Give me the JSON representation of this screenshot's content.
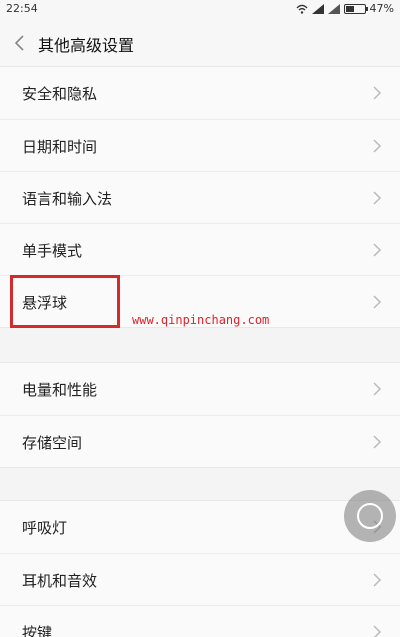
{
  "status_bar": {
    "time": "22:54",
    "battery_percent": "47%",
    "battery_level": 0.47,
    "icons": [
      "wifi-icon",
      "signal-icon",
      "signal-icon",
      "battery-icon"
    ]
  },
  "header": {
    "title": "其他高级设置",
    "back_icon": "chevron-left-icon"
  },
  "groups": [
    {
      "items": [
        {
          "label": "安全和隐私"
        },
        {
          "label": "日期和时间"
        },
        {
          "label": "语言和输入法"
        },
        {
          "label": "单手模式"
        },
        {
          "label": "悬浮球"
        }
      ]
    },
    {
      "items": [
        {
          "label": "电量和性能"
        },
        {
          "label": "存储空间"
        }
      ]
    },
    {
      "items": [
        {
          "label": "呼吸灯"
        },
        {
          "label": "耳机和音效"
        },
        {
          "label": "按键"
        }
      ]
    }
  ],
  "watermark": "www.qinpinchang.com",
  "colors": {
    "highlight": "#d12b2b",
    "watermark": "#e0222a",
    "background": "#f4f4f4"
  }
}
